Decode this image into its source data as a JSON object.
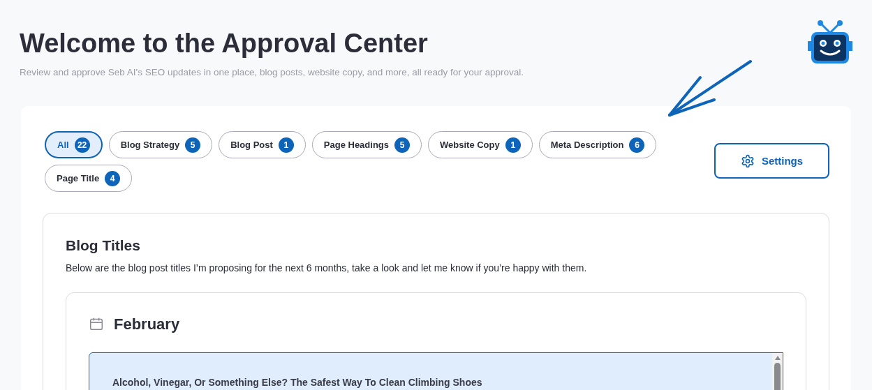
{
  "header": {
    "title": "Welcome to the Approval Center",
    "subtitle": "Review and approve Seb AI's SEO updates in one place, blog posts, website copy, and more, all ready for your approval."
  },
  "filters": [
    {
      "label": "All",
      "count": "22",
      "selected": true
    },
    {
      "label": "Blog Strategy",
      "count": "5",
      "selected": false
    },
    {
      "label": "Blog Post",
      "count": "1",
      "selected": false
    },
    {
      "label": "Page Headings",
      "count": "5",
      "selected": false
    },
    {
      "label": "Website Copy",
      "count": "1",
      "selected": false
    },
    {
      "label": "Meta Description",
      "count": "6",
      "selected": false
    },
    {
      "label": "Page Title",
      "count": "4",
      "selected": false
    }
  ],
  "settings_button": "Settings",
  "section": {
    "title": "Blog Titles",
    "description": "Below are the blog post titles I’m proposing for the next 6 months, take a look and let me know if you’re happy with them.",
    "month": "February",
    "items": [
      {
        "title": "Alcohol, Vinegar, Or Something Else? The Safest Way To Clean Climbing Shoes",
        "selected": true
      }
    ]
  }
}
